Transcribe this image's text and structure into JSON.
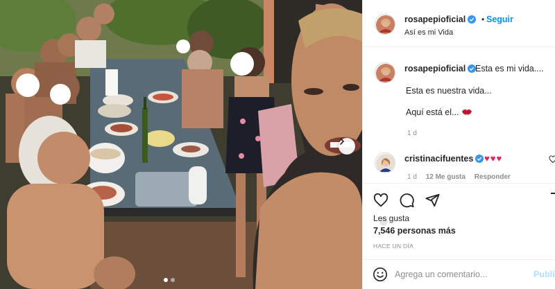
{
  "post": {
    "author": "rosapepioficial",
    "follow_label": "Seguir",
    "separator": "•",
    "location": "Así es mi Vida"
  },
  "caption": {
    "username": "rosapepioficial",
    "line1": "Esta es mi vida....",
    "line2": "Esta es nuestra vida...",
    "line3": "Aquí está el...",
    "time": "1 d"
  },
  "comment": {
    "username": "cristinacifuentes",
    "text": "♥♥♥",
    "time": "1 d",
    "likes": "12 Me gusta",
    "reply": "Responder"
  },
  "likes": {
    "prefix": "Les gusta",
    "count": "7,546 personas más"
  },
  "timestamp": "HACE UN DÍA",
  "add_comment": {
    "placeholder": "Agrega un comentario...",
    "publish": "Publicar"
  },
  "carousel": {
    "current": 1,
    "total": 2
  },
  "icons": {
    "heart": "heart-icon",
    "comment": "comment-icon",
    "share": "send-icon",
    "save": "bookmark-icon",
    "emoji": "smiley-icon",
    "next": "chevron-right-icon",
    "verified": "verified-badge-icon"
  },
  "colors": {
    "link": "#0095f6",
    "verified": "#3897f0",
    "muted": "#8e8e8e",
    "heart": "#e0245e"
  }
}
